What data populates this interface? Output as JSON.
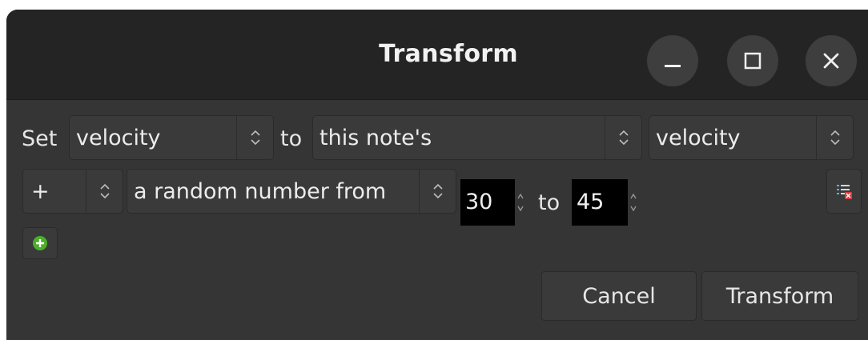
{
  "window": {
    "title": "Transform",
    "controls": [
      "minimize-icon",
      "maximize-icon",
      "close-icon"
    ]
  },
  "rule_row": {
    "set_label": "Set",
    "property": "velocity",
    "to_label": "to",
    "source": "this note's",
    "source_property": "velocity"
  },
  "operation_row": {
    "operator": "+",
    "value_type": "a random number from",
    "from_value": "30",
    "to_label": "to",
    "to_value": "45",
    "remove_icon": "list-remove-icon"
  },
  "add_row": {
    "icon": "add-icon",
    "color": "#4caf2a"
  },
  "buttons": {
    "cancel": "Cancel",
    "transform": "Transform"
  },
  "colors": {
    "titlebar": "#242424",
    "body": "#353535",
    "field": "#000000",
    "text": "#e6e6e6"
  }
}
